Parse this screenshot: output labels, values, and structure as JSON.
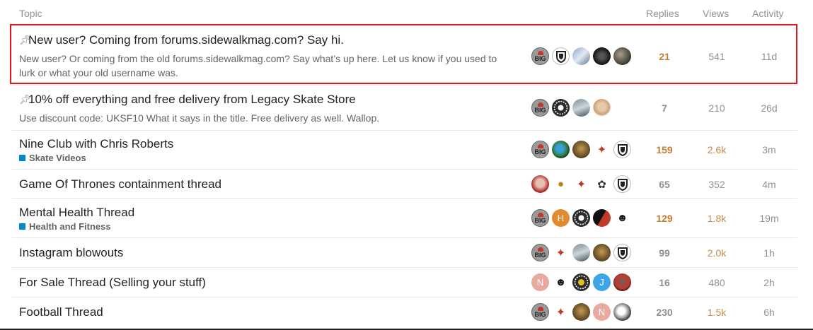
{
  "header": {
    "topic": "Topic",
    "replies": "Replies",
    "views": "Views",
    "activity": "Activity"
  },
  "topics": [
    {
      "title": "New user? Coming from forums.sidewalkmag.com? Say hi.",
      "pinned": true,
      "excerpt": "New user? Or coming from the old forums.sidewalkmag.com? Say what’s up here. Let us know if you used to lurk or what your old username was.",
      "replies": "21",
      "views": "541",
      "activity": "11d",
      "avatars": [
        "big",
        "shield",
        "photo-blue",
        "dark-logo",
        "photo-dark"
      ]
    },
    {
      "title": "10% off everything and free delivery from Legacy Skate Store",
      "pinned": true,
      "excerpt": "Use discount code: UKSF10 What it says in the title. Free delivery as well. Wallop.",
      "replies": "7",
      "views": "210",
      "activity": "26d",
      "avatars": [
        "big",
        "wreath",
        "photo-gray",
        "photo-face"
      ]
    },
    {
      "title": "Nine Club with Chris Roberts",
      "category": "Skate Videos",
      "category_color": "#0088cc",
      "replies": "159",
      "views": "2.6k",
      "activity": "3m",
      "avatars": [
        "big",
        "globe",
        "photo-brown",
        "duck",
        "shield"
      ]
    },
    {
      "title": "Game Of Thrones containment thread",
      "replies": "65",
      "views": "352",
      "activity": "4m",
      "avatars": [
        "photo-face",
        "small-gold",
        "duck",
        "bird",
        "shield"
      ]
    },
    {
      "title": "Mental Health Thread",
      "category": "Health and Fitness",
      "category_color": "#0088cc",
      "replies": "129",
      "views": "1.8k",
      "activity": "19m",
      "avatars": [
        "big",
        "letter-H",
        "wreath",
        "photo-red",
        "cartoon"
      ]
    },
    {
      "title": "Instagram blowouts",
      "replies": "99",
      "views": "2.0k",
      "activity": "1h",
      "avatars": [
        "big",
        "duck",
        "photo-gray",
        "photo-brown",
        "shield"
      ]
    },
    {
      "title": "For Sale Thread (Selling your stuff)",
      "replies": "16",
      "views": "480",
      "activity": "2h",
      "avatars": [
        "letter-N",
        "cartoon",
        "wreath-gold",
        "letter-J",
        "photo-red"
      ]
    },
    {
      "title": "Football Thread",
      "replies": "230",
      "views": "1.5k",
      "activity": "6h",
      "avatars": [
        "big",
        "duck",
        "photo-brown",
        "letter-N",
        "bw"
      ]
    }
  ],
  "avatar_text": {
    "big_label": "BIG",
    "letter_H": "H",
    "letter_N": "N",
    "letter_J": "J"
  },
  "colors": {
    "highlight_border": "#e5151e",
    "hot_replies": "#c67d32",
    "hot_views": "#c9884a",
    "category": "#0088cc"
  }
}
